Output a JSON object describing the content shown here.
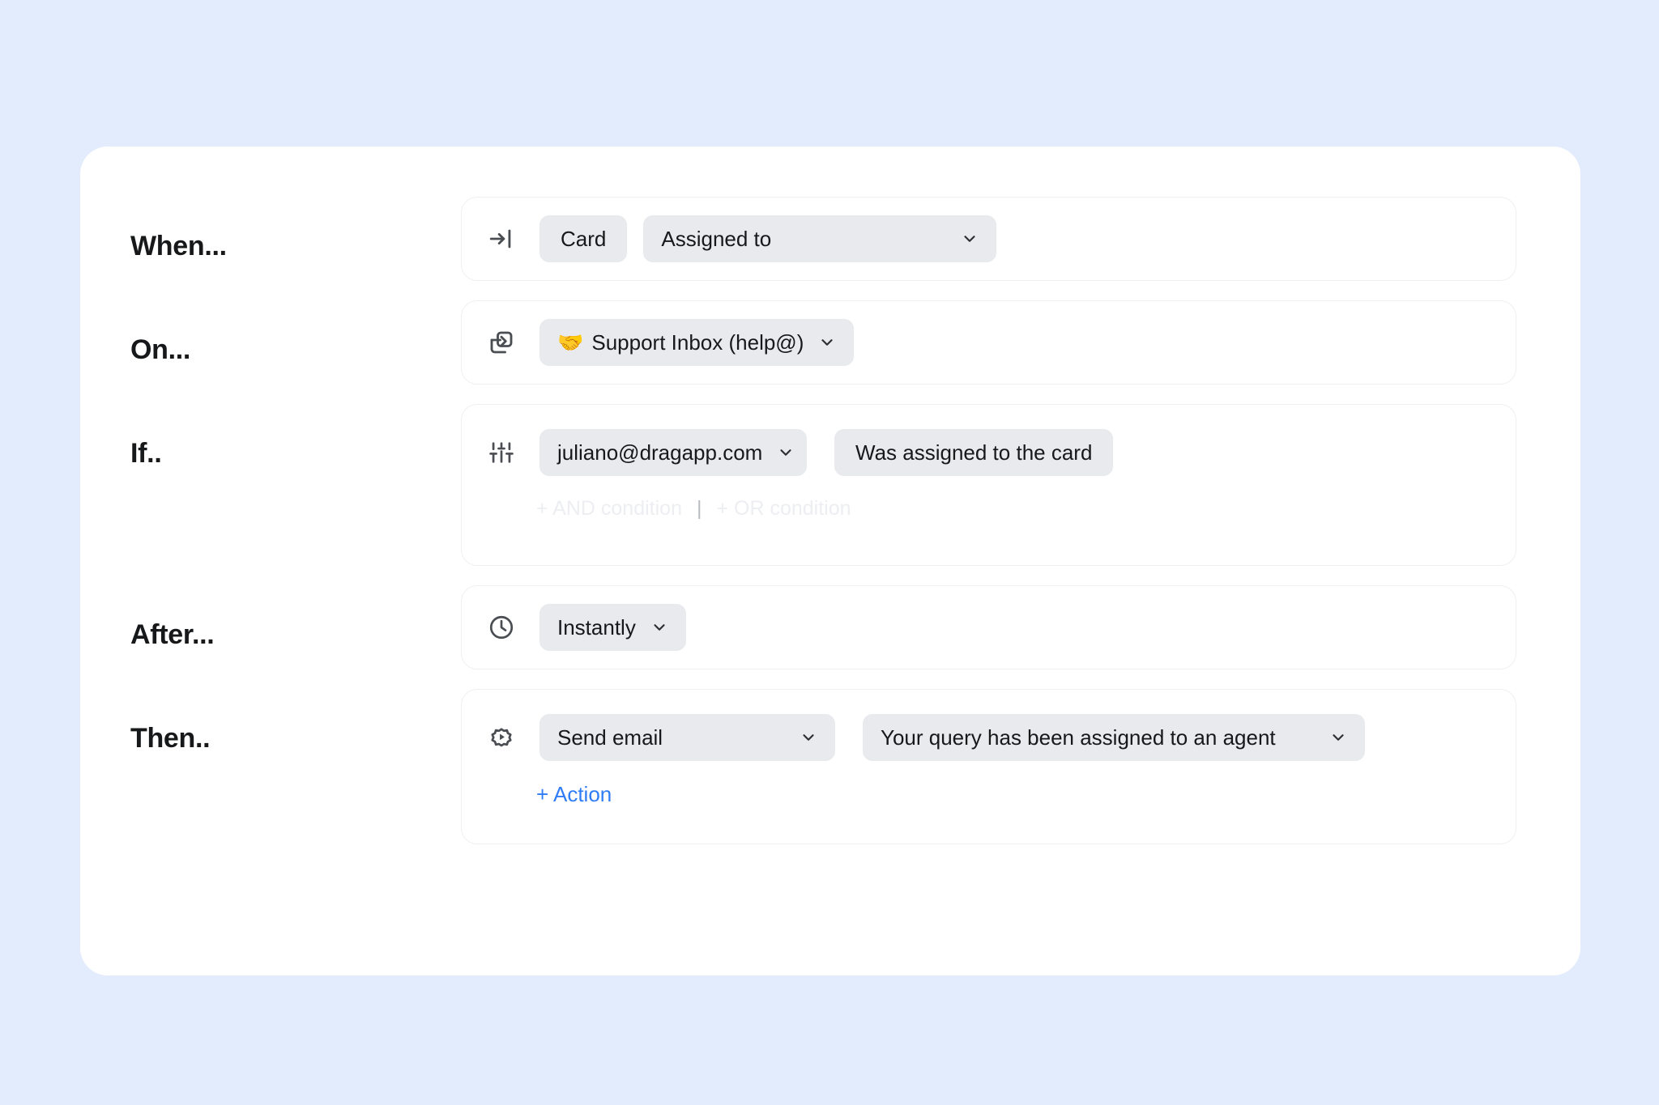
{
  "theme": {
    "page_background": "#e2ecfd",
    "card_background": "#ffffff",
    "pill_background": "#e8eaed",
    "text_color": "#17181a",
    "link_color": "#2f7df6",
    "muted_link_color": "#eceef1"
  },
  "rules": {
    "when": {
      "label": "When...",
      "icon": "arrow-to-line-right-icon",
      "object_tag": "Card",
      "event_select": "Assigned to"
    },
    "on": {
      "label": "On...",
      "icon": "board-move-icon",
      "board_emoji": "🤝",
      "board_select": "Support Inbox (help@)"
    },
    "if": {
      "label": "If..",
      "icon": "sliders-icon",
      "subject_select": "juliano@dragapp.com",
      "condition_tag": "Was assigned to the card",
      "and_condition_link": "+ AND condition",
      "separator": "|",
      "or_condition_link": "+ OR condition"
    },
    "after": {
      "label": "After...",
      "icon": "clock-icon",
      "delay_select": "Instantly"
    },
    "then": {
      "label": "Then..",
      "icon": "gear-play-icon",
      "action_select": "Send email",
      "template_select": "Your query has been assigned to an agent",
      "add_action_link": "+ Action"
    }
  }
}
